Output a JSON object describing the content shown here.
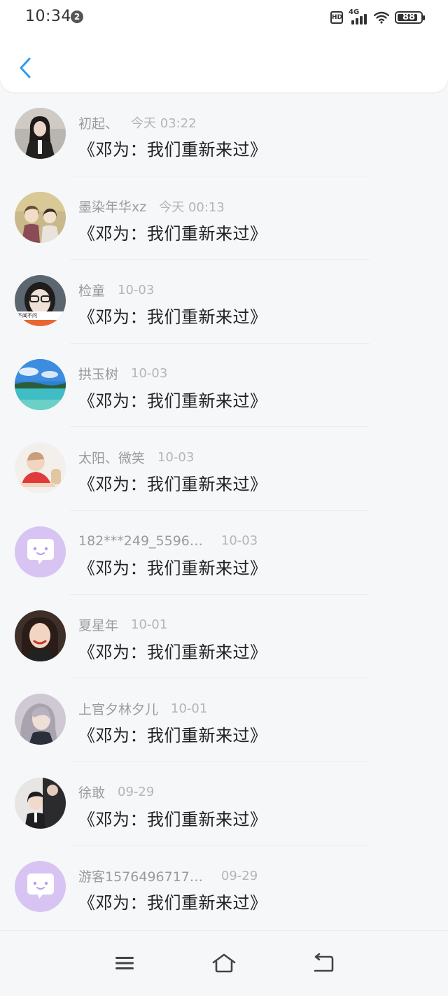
{
  "status_bar": {
    "time": "10:34",
    "notification_count": "2",
    "hd_label": "HD",
    "network_label": "4G",
    "battery": "88"
  },
  "colors": {
    "accent": "#2e9bf0",
    "name_text": "#9b9b9b",
    "time_text": "#b5b5b5",
    "body_text": "#222222",
    "background": "#f6f7f9"
  },
  "comments": [
    {
      "name": "初起、",
      "time": "今天 03:22",
      "text": "《邓为：我们重新来过》",
      "avatar": "girl-dark-hair"
    },
    {
      "name": "墨染年华xz",
      "time": "今天 00:13",
      "text": "《邓为：我们重新来过》",
      "avatar": "anime-couple"
    },
    {
      "name": "检童",
      "time": "10-03",
      "text": "《邓为：我们重新来过》",
      "avatar": "glasses-girl"
    },
    {
      "name": "拱玉树",
      "time": "10-03",
      "text": "《邓为：我们重新来过》",
      "avatar": "ocean-island"
    },
    {
      "name": "太阳、微笑",
      "time": "10-03",
      "text": "《邓为：我们重新来过》",
      "avatar": "baby"
    },
    {
      "name": "182***249_5596…",
      "time": "10-03",
      "text": "《邓为：我们重新来过》",
      "avatar": "default-chat-icon"
    },
    {
      "name": "夏星年",
      "time": "10-01",
      "text": "《邓为：我们重新来过》",
      "avatar": "smiling-girl"
    },
    {
      "name": "上官夕林夕儿",
      "time": "10-01",
      "text": "《邓为：我们重新来过》",
      "avatar": "silver-hair-girl"
    },
    {
      "name": "徐敢",
      "time": "09-29",
      "text": "《邓为：我们重新来过》",
      "avatar": "office-couple"
    },
    {
      "name": "游客1576496717…",
      "time": "09-29",
      "text": "《邓为：我们重新来过》",
      "avatar": "default-chat-icon"
    }
  ],
  "bottom_nav": {
    "icons": [
      "menu-icon",
      "home-icon",
      "back-icon"
    ]
  }
}
